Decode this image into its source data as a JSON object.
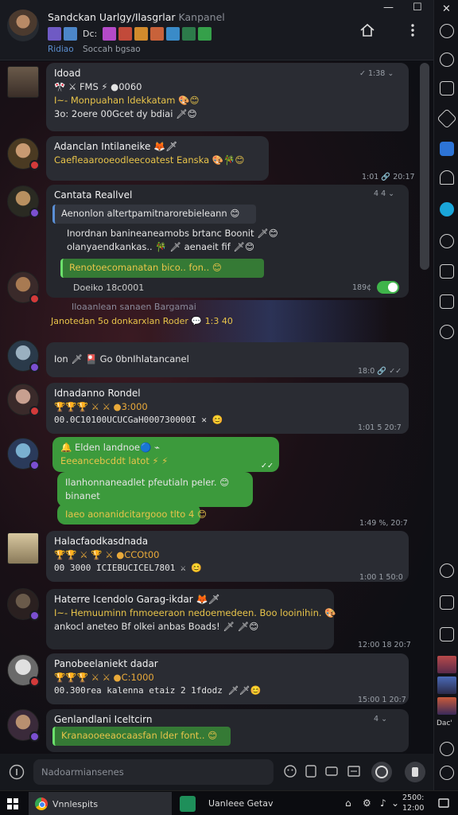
{
  "window": {
    "minimize_glyph": "—",
    "maximize_glyph": "☐",
    "close_glyph": "✕"
  },
  "header": {
    "title": "Sandckan Uarlgy/Ilasgrlar",
    "title_tag": "Kanpanel",
    "sticker_text": "Dc:",
    "subtitle_a": "Ridiao",
    "subtitle_b": "Soccah bgsao",
    "home_icon": "home-icon",
    "menu_icon": "more-vertical-icon"
  },
  "messages": [
    {
      "sender": "Idoad",
      "lines": [
        "🎌 ⚔ FMS ⚡ ●0060",
        "I~- Monpuahan ldekkatam 🎨😊",
        "3o: 2oere 00Gcet dy bdiai 🗡😊"
      ],
      "time": "✓ 1:38 ⌄"
    },
    {
      "sender": "Adanclan Intilaneike 🦊🗡",
      "lines": [
        "Caefleaarooeodleecoatest Eanska 🎨🎋😊"
      ],
      "time": "1:01 🔗 20:17"
    },
    {
      "sender": "Cantata Reallvel",
      "time_top": "4 4 ⌄",
      "quote_lines": [
        "Aenonlon altertpamitnarorebieleann 😊"
      ],
      "lines": [
        "Inordnan banineaneamobs brtanc Boonit 🗡😊",
        "olanyaendkankas.. 🎋 🗡 aenaeit fif 🗡😊"
      ],
      "green_line": "Renotoecomanatan bico.. fon.. 😊",
      "footer": "Doeiko 18c0001",
      "time": "189¢"
    },
    {
      "floating_a": "Iloaanlean sanaen Bargamai",
      "floating_b": "Janotedan 5o donkarxlan Roder 💬 1:3 40"
    },
    {
      "lines": [
        "Ion 🗡 🎴 Go 0bnIhlatancanel"
      ],
      "time": "18:0 🔗 ✓✓"
    },
    {
      "sender": "Idnadanno Rondel",
      "sub": "🏆🏆🏆 ⚔ ⚔ ●3:000",
      "lines": [
        "00.0C10100UCUCGaH000730000I ✕ 😊"
      ],
      "time": "1:01 5 20:7"
    },
    {
      "green": true,
      "title": "🔔 Elden landnoe🔵 ⌁",
      "sub": "Eeeancebcddt latot ⚡ ⚡",
      "lines": [
        "Ilanhonnaneadlet pfeutialn peler. 😊",
        "binanet"
      ],
      "tail": "Iaeo aonanidcitargooo tlto 4 😊",
      "read": "✓✓"
    },
    {
      "time_only": "1:49 %, 20:7"
    },
    {
      "sender": "Halacfaodkasdnada",
      "sub": "🏆🏆 ⚔ 🏆 ⚔ ●CCOt00",
      "lines": [
        "00 3000 ICIEBUCICEL7801 ⚔ 😊"
      ],
      "time": "1:00 1 50:0"
    },
    {
      "sender": "Haterre Icendolo Garag-ikdar 🦊🗡",
      "lines": [
        "I~- Hemuuminn fnmoeeraon nedoemedeen. Boo looinihin. 🎨",
        "ankocl aneteo Bf olkei anbas Boads! 🗡 🗡😊"
      ],
      "time": "12:00 18 20:7"
    },
    {
      "sender": "Panobeelaniekt dadar",
      "sub": "🏆🏆🏆 ⚔ ⚔ ●C:1000",
      "lines": [
        "00.300rea kalenna etaiz 2 1fdodz 🗡🗡😊"
      ],
      "time": "15:00 1 20:7"
    },
    {
      "sender": "Genlandlani Iceltcirn",
      "green_line": "Kranaooeeaocaasfan lder font.. 😊",
      "time": "4 ⌄"
    }
  ],
  "input": {
    "placeholder": "Nadoarmiansenes",
    "left_icon": "info-icon",
    "icons": [
      "emoji-icon",
      "attach-icon",
      "gif-icon",
      "sticker-icon",
      "voice-icon",
      "send-icon"
    ]
  },
  "taskbar": {
    "chrome_label": "Vnnlespits",
    "app_label": "Uanleee Getav",
    "clock_top": "2500:",
    "clock_bottom": "12:00",
    "tray_icons": [
      "notification-icon",
      "settings-icon",
      "sound-icon",
      "chevron-down-icon"
    ]
  },
  "sidebar": {
    "bottom_label": "Dac'"
  },
  "colors": {
    "green_bubble": "#3c9a3c",
    "accent_blue": "#2d74d6",
    "status_green": "#3fb44a"
  }
}
